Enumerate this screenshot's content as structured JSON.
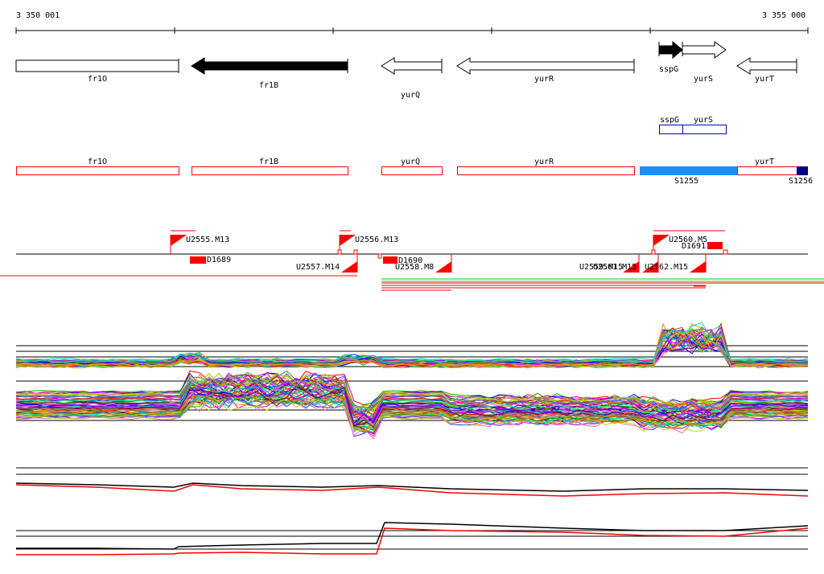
{
  "coords": {
    "start": "3 350 001",
    "end": "3 355 000"
  },
  "colors": {
    "accent_red": "#ff0000",
    "gene_black": "#000000",
    "segment_blue": "#1a90ff",
    "segment_dark_blue": "#000080",
    "operon_blue": "#0000cc",
    "green": "#00cc00"
  },
  "genes": [
    {
      "name": "fr1O",
      "strand": "+",
      "filled": false
    },
    {
      "name": "fr1B",
      "strand": "-",
      "filled": true
    },
    {
      "name": "yurQ",
      "strand": "-",
      "filled": false
    },
    {
      "name": "yurR",
      "strand": "-",
      "filled": false
    },
    {
      "name": "sspG",
      "strand": "+",
      "filled": true
    },
    {
      "name": "yurS",
      "strand": "+",
      "filled": false
    },
    {
      "name": "yurT",
      "strand": "-",
      "filled": false
    }
  ],
  "operons": [
    "sspG",
    "yurS"
  ],
  "gene_boxes": [
    "fr1O",
    "fr1B",
    "yurQ",
    "yurR",
    "yurT"
  ],
  "segments": [
    "S1255",
    "S1256"
  ],
  "probes": [
    "U2555.M13",
    "U2556.M13",
    "U2560.M5",
    "D1691",
    "D1689",
    "U2557.M14",
    "D1690",
    "U2558.M8",
    "U2559.M15",
    "U2561.M15",
    "U2562.M15"
  ]
}
